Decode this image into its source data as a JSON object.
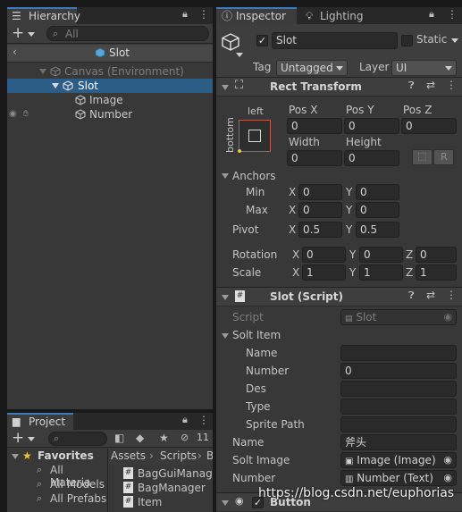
{
  "hierarchy": {
    "tab_label": "Hierarchy",
    "search_placeholder": "All",
    "breadcrumb": "Slot",
    "items": [
      {
        "label": "Canvas (Environment)"
      },
      {
        "label": "Slot"
      },
      {
        "label": "Image"
      },
      {
        "label": "Number"
      }
    ]
  },
  "project": {
    "tab_label": "Project",
    "hidden_count": "11",
    "favorites_label": "Favorites",
    "favorites": [
      "All Materia",
      "All Models",
      "All Prefabs"
    ],
    "breadcrumb": [
      "Assets",
      "Scripts",
      "B"
    ],
    "files": [
      "BagGuiManage",
      "BagManager",
      "Item"
    ]
  },
  "inspector": {
    "tabs": [
      "Inspector",
      "Lighting"
    ],
    "object_name": "Slot",
    "static_label": "Static",
    "tag_label": "Tag",
    "tag_value": "Untagged",
    "layer_label": "Layer",
    "layer_value": "UI",
    "rect_transform": {
      "title": "Rect Transform",
      "anchor_h": "left",
      "anchor_v": "bottom",
      "posx_label": "Pos X",
      "posy_label": "Pos Y",
      "posz_label": "Pos Z",
      "posx": "0",
      "posy": "0",
      "posz": "0",
      "width_label": "Width",
      "height_label": "Height",
      "width": "0",
      "height": "0",
      "raw_button": "R",
      "anchors_label": "Anchors",
      "min_label": "Min",
      "max_label": "Max",
      "min_x": "0",
      "min_y": "0",
      "max_x": "0",
      "max_y": "0",
      "pivot_label": "Pivot",
      "pivot_x": "0.5",
      "pivot_y": "0.5",
      "rotation_label": "Rotation",
      "rot_x": "0",
      "rot_y": "0",
      "rot_z": "0",
      "scale_label": "Scale",
      "scale_x": "1",
      "scale_y": "1",
      "scale_z": "1",
      "x": "X",
      "y": "Y",
      "z": "Z"
    },
    "slot_script": {
      "title": "Slot (Script)",
      "script_label": "Script",
      "script_value": "Slot",
      "solt_item_label": "Solt Item",
      "fields": [
        {
          "label": "Name",
          "value": ""
        },
        {
          "label": "Number",
          "value": "0"
        },
        {
          "label": "Des",
          "value": ""
        },
        {
          "label": "Type",
          "value": ""
        },
        {
          "label": "Sprite Path",
          "value": ""
        }
      ],
      "name_label": "Name",
      "name_value": "斧头",
      "soltimage_label": "Solt Image",
      "soltimage_value": "Image (Image)",
      "number_label": "Number",
      "number_value": "Number (Text)"
    },
    "button_title": "Button",
    "watermark": "https://blog.csdn.net/euphorias"
  }
}
